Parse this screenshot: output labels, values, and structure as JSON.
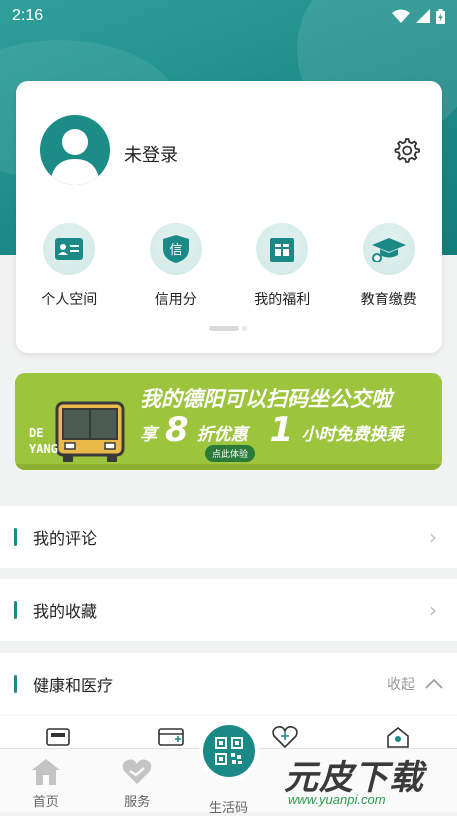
{
  "status_bar": {
    "time": "2:16"
  },
  "profile": {
    "login_text": "未登录",
    "quick_items": [
      {
        "label": "个人空间",
        "icon": "id-card-icon"
      },
      {
        "label": "信用分",
        "icon": "credit-badge-icon"
      },
      {
        "label": "我的福利",
        "icon": "gift-icon"
      },
      {
        "label": "教育缴费",
        "icon": "graduation-cap-icon"
      }
    ]
  },
  "banner": {
    "headline": "我的德阳可以扫码坐公交啦",
    "discount_prefix": "享",
    "discount_number": "8",
    "discount_suffix": "折优惠",
    "free_number": "1",
    "free_suffix": "小时免费换乘",
    "cta": "点此体验",
    "brand_line1": "DE",
    "brand_line2": "YANG"
  },
  "list": {
    "my_comments": "我的评论",
    "my_favorites": "我的收藏",
    "health_section": "健康和医疗",
    "collapse_label": "收起"
  },
  "tabbar": {
    "home": "首页",
    "service": "服务",
    "life_code": "生活码"
  },
  "watermark": {
    "text": "元皮下载",
    "url": "www.yuanpi.com"
  },
  "colors": {
    "primary": "#1b8a86",
    "banner": "#9cc43c"
  }
}
